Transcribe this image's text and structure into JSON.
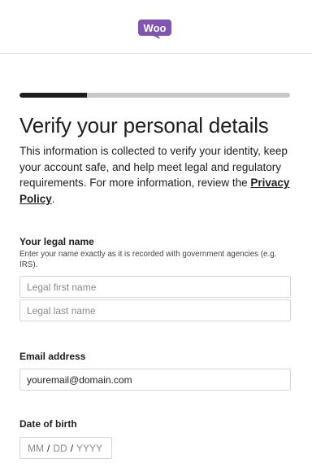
{
  "brand": {
    "logo_text": "Woo",
    "color": "#7f54b3"
  },
  "progress": {
    "percent": 25
  },
  "page": {
    "title": "Verify your personal details",
    "intro": "This information is collected to verify your identity, keep your account safe, and help meet legal and regulatory requirements. For more information, review the ",
    "privacy_link": "Privacy Policy",
    "intro_end": "."
  },
  "legal_name": {
    "label": "Your legal name",
    "help": "Enter your name exactly as it is recorded with government agencies (e.g. IRS).",
    "first_placeholder": "Legal first name",
    "last_placeholder": "Legal last name"
  },
  "email": {
    "label": "Email address",
    "value": "youremail@domain.com"
  },
  "dob": {
    "label": "Date of birth",
    "month_placeholder": "MM",
    "day_placeholder": "DD",
    "year_placeholder": "YYYY",
    "separator": "/"
  }
}
